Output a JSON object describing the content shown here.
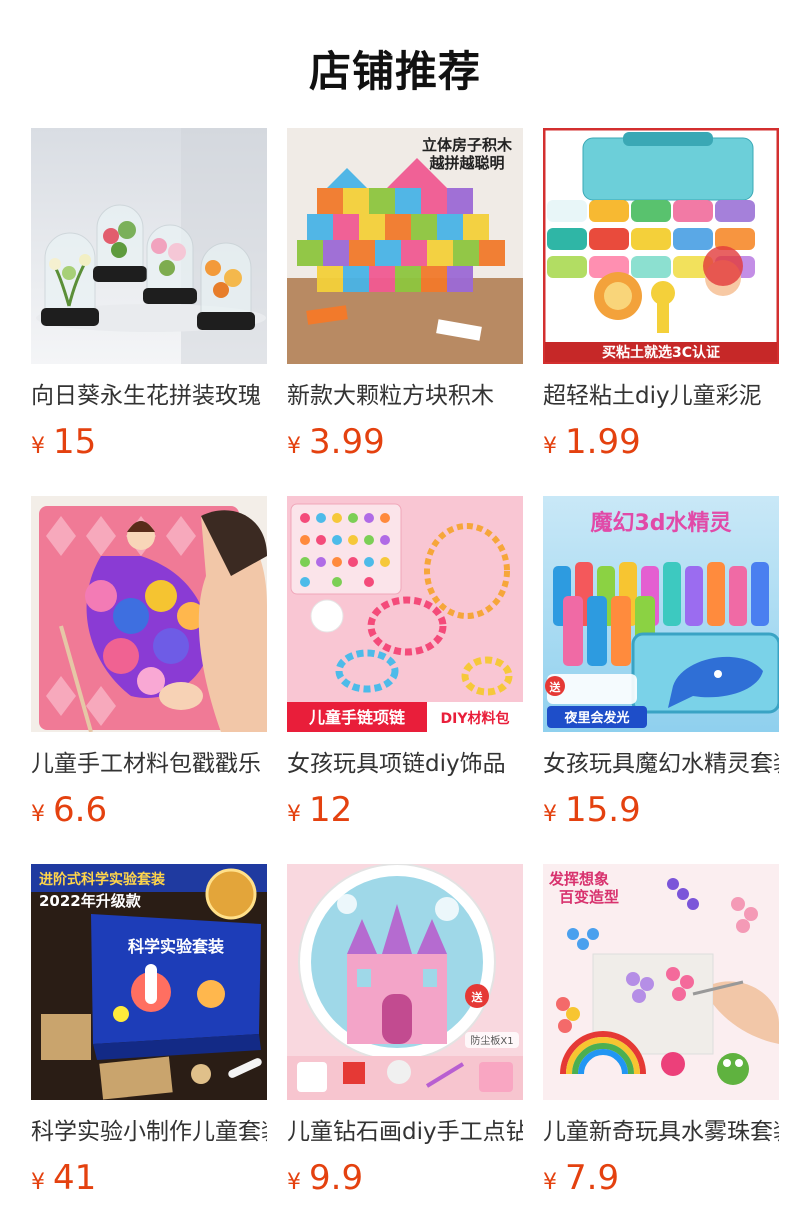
{
  "header": {
    "title": "店铺推荐"
  },
  "currency": "¥",
  "products": [
    {
      "name": "向日葵永生花拼装玫瑰",
      "price": "15",
      "image_icon": "preserved-flower-dome-image"
    },
    {
      "name": "新款大颗粒方块积木",
      "price": "3.99",
      "image_icon": "block-house-toy-image",
      "overlay": [
        "立体房子积木",
        "越拼越聪明"
      ]
    },
    {
      "name": "超轻粘土diy儿童彩泥",
      "price": "1.99",
      "image_icon": "clay-set-image",
      "overlay": [
        "买粘土就选3C认证"
      ]
    },
    {
      "name": "儿童手工材料包戳戳乐",
      "price": "6.6",
      "image_icon": "poke-craft-kit-image"
    },
    {
      "name": "女孩玩具项链diy饰品",
      "price": "12",
      "image_icon": "bead-necklace-kit-image",
      "overlay": [
        "儿童手链项链",
        "DIY材料包"
      ]
    },
    {
      "name": "女孩玩具魔幻水精灵套装",
      "price": "15.9",
      "image_icon": "magic-water-elf-image",
      "overlay": [
        "魔幻3d水精灵",
        "送",
        "夜里会发光"
      ]
    },
    {
      "name": "科学实验小制作儿童套装",
      "price": "41",
      "image_icon": "science-kit-image",
      "overlay": [
        "进阶式科学实验套装",
        "2022年升级款",
        "科学实验套装"
      ]
    },
    {
      "name": "儿童钻石画diy手工点钻",
      "price": "9.9",
      "image_icon": "diamond-painting-image",
      "overlay": [
        "送",
        "防尘板X1"
      ]
    },
    {
      "name": "儿童新奇玩具水雾珠套装",
      "price": "7.9",
      "image_icon": "water-mist-beads-image",
      "overlay": [
        "发挥想象",
        "百变造型"
      ]
    }
  ],
  "colors": {
    "price": "#e4410f",
    "title": "#111111",
    "name": "#333333"
  }
}
